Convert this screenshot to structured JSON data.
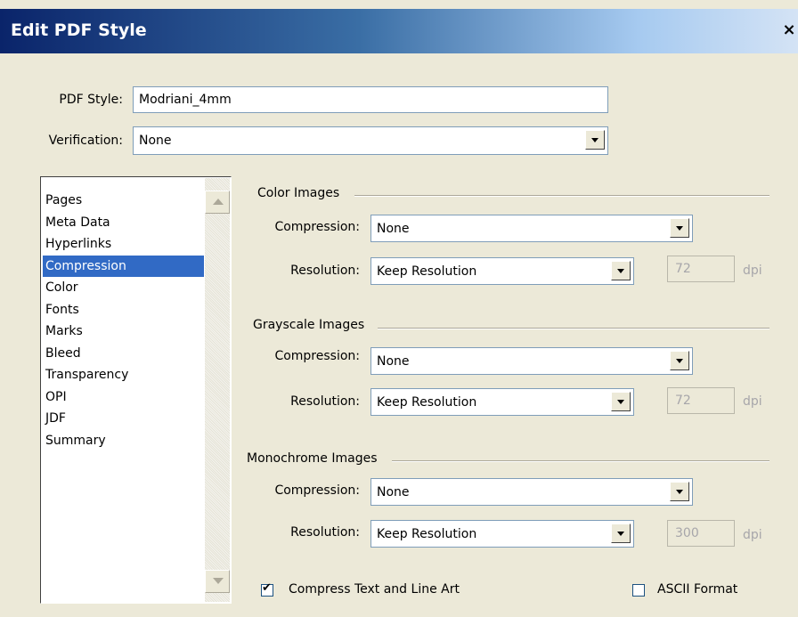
{
  "window": {
    "title": "Edit PDF Style",
    "close": "×"
  },
  "pdf_style": {
    "label": "PDF Style:",
    "value": "Modriani_4mm"
  },
  "verification": {
    "label": "Verification:",
    "value": "None"
  },
  "nav": {
    "items": [
      "Pages",
      "Meta Data",
      "Hyperlinks",
      "Compression",
      "Color",
      "Fonts",
      "Marks",
      "Bleed",
      "Transparency",
      "OPI",
      "JDF",
      "Summary"
    ],
    "selected": "Compression"
  },
  "color_images": {
    "title": "Color Images",
    "compression_label": "Compression:",
    "compression_value": "None",
    "resolution_label": "Resolution:",
    "resolution_value": "Keep Resolution",
    "dpi_value": "72",
    "dpi_unit": "dpi"
  },
  "grayscale_images": {
    "title": "Grayscale Images",
    "compression_label": "Compression:",
    "compression_value": "None",
    "resolution_label": "Resolution:",
    "resolution_value": "Keep Resolution",
    "dpi_value": "72",
    "dpi_unit": "dpi"
  },
  "monochrome_images": {
    "title": "Monochrome Images",
    "compression_label": "Compression:",
    "compression_value": "None",
    "resolution_label": "Resolution:",
    "resolution_value": "Keep Resolution",
    "dpi_value": "300",
    "dpi_unit": "dpi"
  },
  "options": {
    "compress_text": {
      "label": "Compress Text and Line Art",
      "checked": true
    },
    "ascii_format": {
      "label": "ASCII Format",
      "checked": false
    }
  }
}
